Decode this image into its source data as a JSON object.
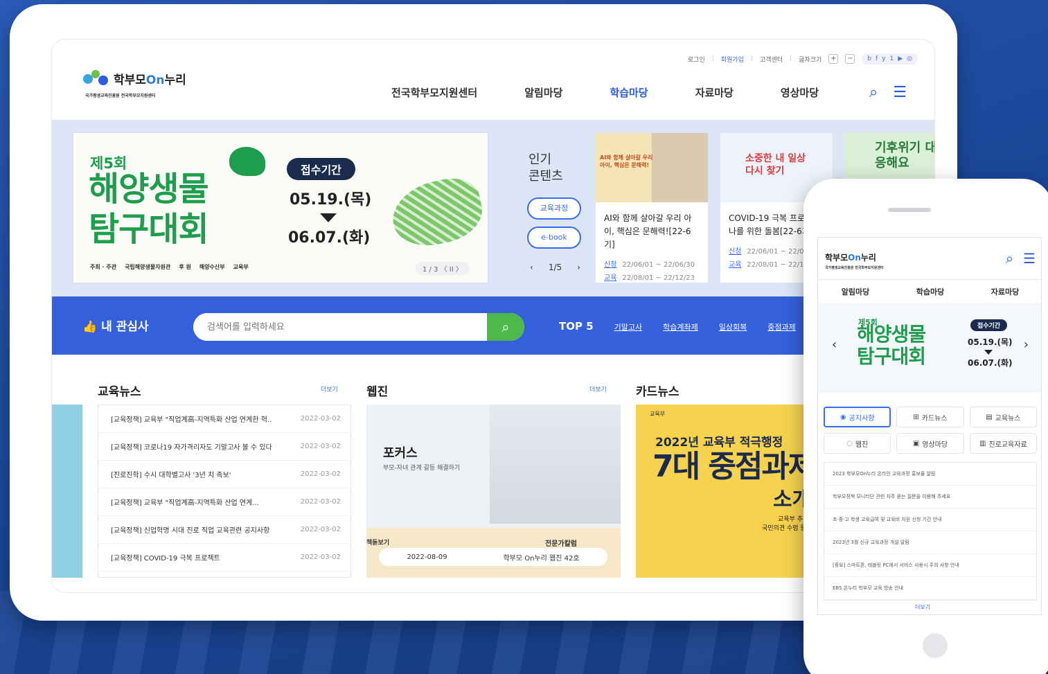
{
  "topbar": {
    "login": "로그인",
    "join": "회원가입",
    "customer": "고객센터",
    "font_size": "글자크기",
    "font_plus": "+",
    "font_minus": "−",
    "social": [
      "b",
      "f",
      "y",
      "1",
      "▶",
      "◎"
    ]
  },
  "logo": {
    "name_pre": "학부모",
    "name_on": "On",
    "name_post": "누리",
    "subtitle": "국가평생교육진흥원 전국학부모지원센터"
  },
  "gnb": [
    "전국학부모지원센터",
    "알림마당",
    "학습마당",
    "자료마당",
    "영상마당"
  ],
  "banner": {
    "round": "제5회",
    "title_line1": "해양생물",
    "title_line2": "탐구대회",
    "period_label": "접수기간",
    "date_start": "05.19.(목)",
    "date_end": "06.07.(화)",
    "host": "주최 · 주관",
    "host_org": "국립해양생물자원관",
    "sponsor": "후 원",
    "sponsor_org1": "해양수산부",
    "sponsor_org2": "교육부",
    "pager": "1 / 3  〈  II  〉"
  },
  "popular": {
    "title_line1": "인기",
    "title_line2": "콘텐츠",
    "pills": [
      "교육과정",
      "e-book"
    ],
    "pager": "1/5",
    "cards": [
      {
        "img_text": "AI와 함께 살아갈 우리 아이, 핵심은 문해력!",
        "title": "AI와 함께 살아갈 우리 아이, 핵심은 문해력![22-6기]",
        "apply_label": "신청",
        "apply": "22/06/01 ~ 22/06/30",
        "edu_label": "교육",
        "edu": "22/08/01 ~ 22/12/23"
      },
      {
        "img_text": "소중한 내 일상 다시 찾기",
        "title": "COVID-19 극복 프로젝트 나를 위한 돌봄[22-6기]",
        "apply_label": "신청",
        "apply": "22/06/01 ~ 22/06/",
        "edu_label": "교육",
        "edu": "22/08/01 ~ 22/12/"
      },
      {
        "img_text": "기후위기 대응해요"
      }
    ]
  },
  "search": {
    "label": "내 관심사",
    "placeholder": "검색어를 입력하세요",
    "top5_label": "TOP 5",
    "keywords": [
      "기말고사",
      "학습계좌제",
      "일상회복",
      "중점과제"
    ]
  },
  "edu_news": {
    "title": "교육뉴스",
    "more": "더보기",
    "items": [
      {
        "text": "[교육정책] 교육부 \"직업계高-지역특화 산업 연계한 혁..",
        "date": "2022-03-02"
      },
      {
        "text": "[교육정책] 코로나19 자가격리자도 기말고사 볼 수 있다",
        "date": "2022-03-02"
      },
      {
        "text": "[진로진학] 수시 대학별고사 '3년 치 족보'",
        "date": "2022-03-02"
      },
      {
        "text": "[교육정책] 교육부 \"직업계高-지역특화 산업 연계...",
        "date": "2022-03-02"
      },
      {
        "text": "[교육정책] 신업혁명 시대 진로 직업 교육관련 공지사항",
        "date": "2022-03-02"
      },
      {
        "text": "[교육정책] COVID-19 극복 프로젝트",
        "date": "2022-03-02"
      }
    ]
  },
  "webzine": {
    "title": "웹진",
    "more": "더보기",
    "focus": "포커스",
    "focus_sub": "부모-자녀 관계 갈등 해결하기",
    "tag_left": "책돋보기",
    "tag_right": "전문가칼럼",
    "date": "2022-08-09",
    "issue": "학부모 On누리 웹진 42호"
  },
  "card_news": {
    "title": "카드뉴스",
    "ministry": "교육부",
    "headline": "2022년 교육부 적극행정",
    "big": "7대 중점과제",
    "big2": "소개",
    "foot1": "교육부 추진",
    "foot2": "국민의견 수렴 등을"
  },
  "phone": {
    "gnb": [
      "알림마당",
      "학습마당",
      "자료마당"
    ],
    "hero": {
      "round": "제5회",
      "t1": "해양생물",
      "t2": "탐구대회",
      "chip": "접수기간",
      "d1": "05.19.(목)",
      "d2": "06.07.(화)"
    },
    "tabs": [
      "공지사항",
      "카드뉴스",
      "교육뉴스",
      "웹진",
      "영상마당",
      "진로교육자료"
    ],
    "list": [
      "2023 학부모On누리 온라인 교육과정 홍보물 알림",
      "학부모정책 모니터단 관련 자주 묻는 질문을 이용해 주세요",
      "초·중·고 학생 교육급여 및 교육비 지원 신청 기간 안내",
      "2023년 3월 신규 교육과정 개설 알림",
      "[중요] 스마트폰, 태블릿 PC에서 서비스 사용시 주의 사항 안내",
      "EBS 온누리 학부모 교육 방송 안내"
    ],
    "more": "더보기"
  }
}
